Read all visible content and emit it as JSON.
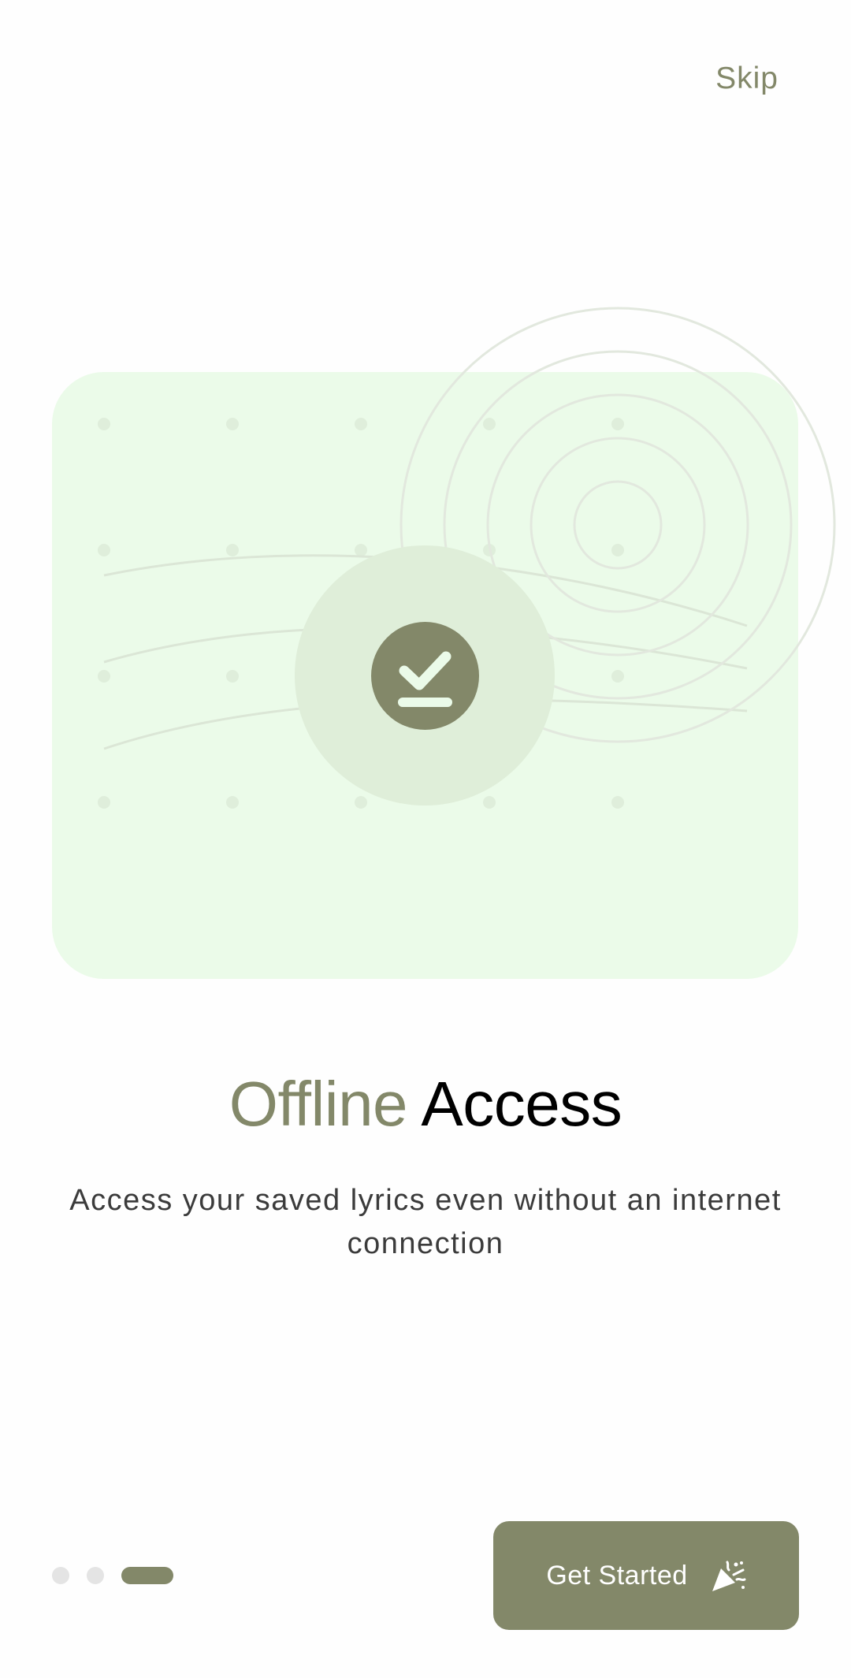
{
  "header": {
    "skip_label": "Skip"
  },
  "illustration": {
    "icon": "download-done-icon",
    "card_color": "#ebfbe9",
    "halo_color": "#dfeed9"
  },
  "onboarding": {
    "title_accent": "Offline",
    "title_rest": "Access",
    "description": "Access your saved lyrics even without an internet connection"
  },
  "pager": {
    "total_pages": 3,
    "current_page": 3
  },
  "cta": {
    "label": "Get Started",
    "icon": "party-popper-icon"
  },
  "colors": {
    "accent": "#838869",
    "text_primary": "#000000",
    "text_secondary": "#3b3b3b",
    "inactive_dot": "#e4e4e4"
  }
}
